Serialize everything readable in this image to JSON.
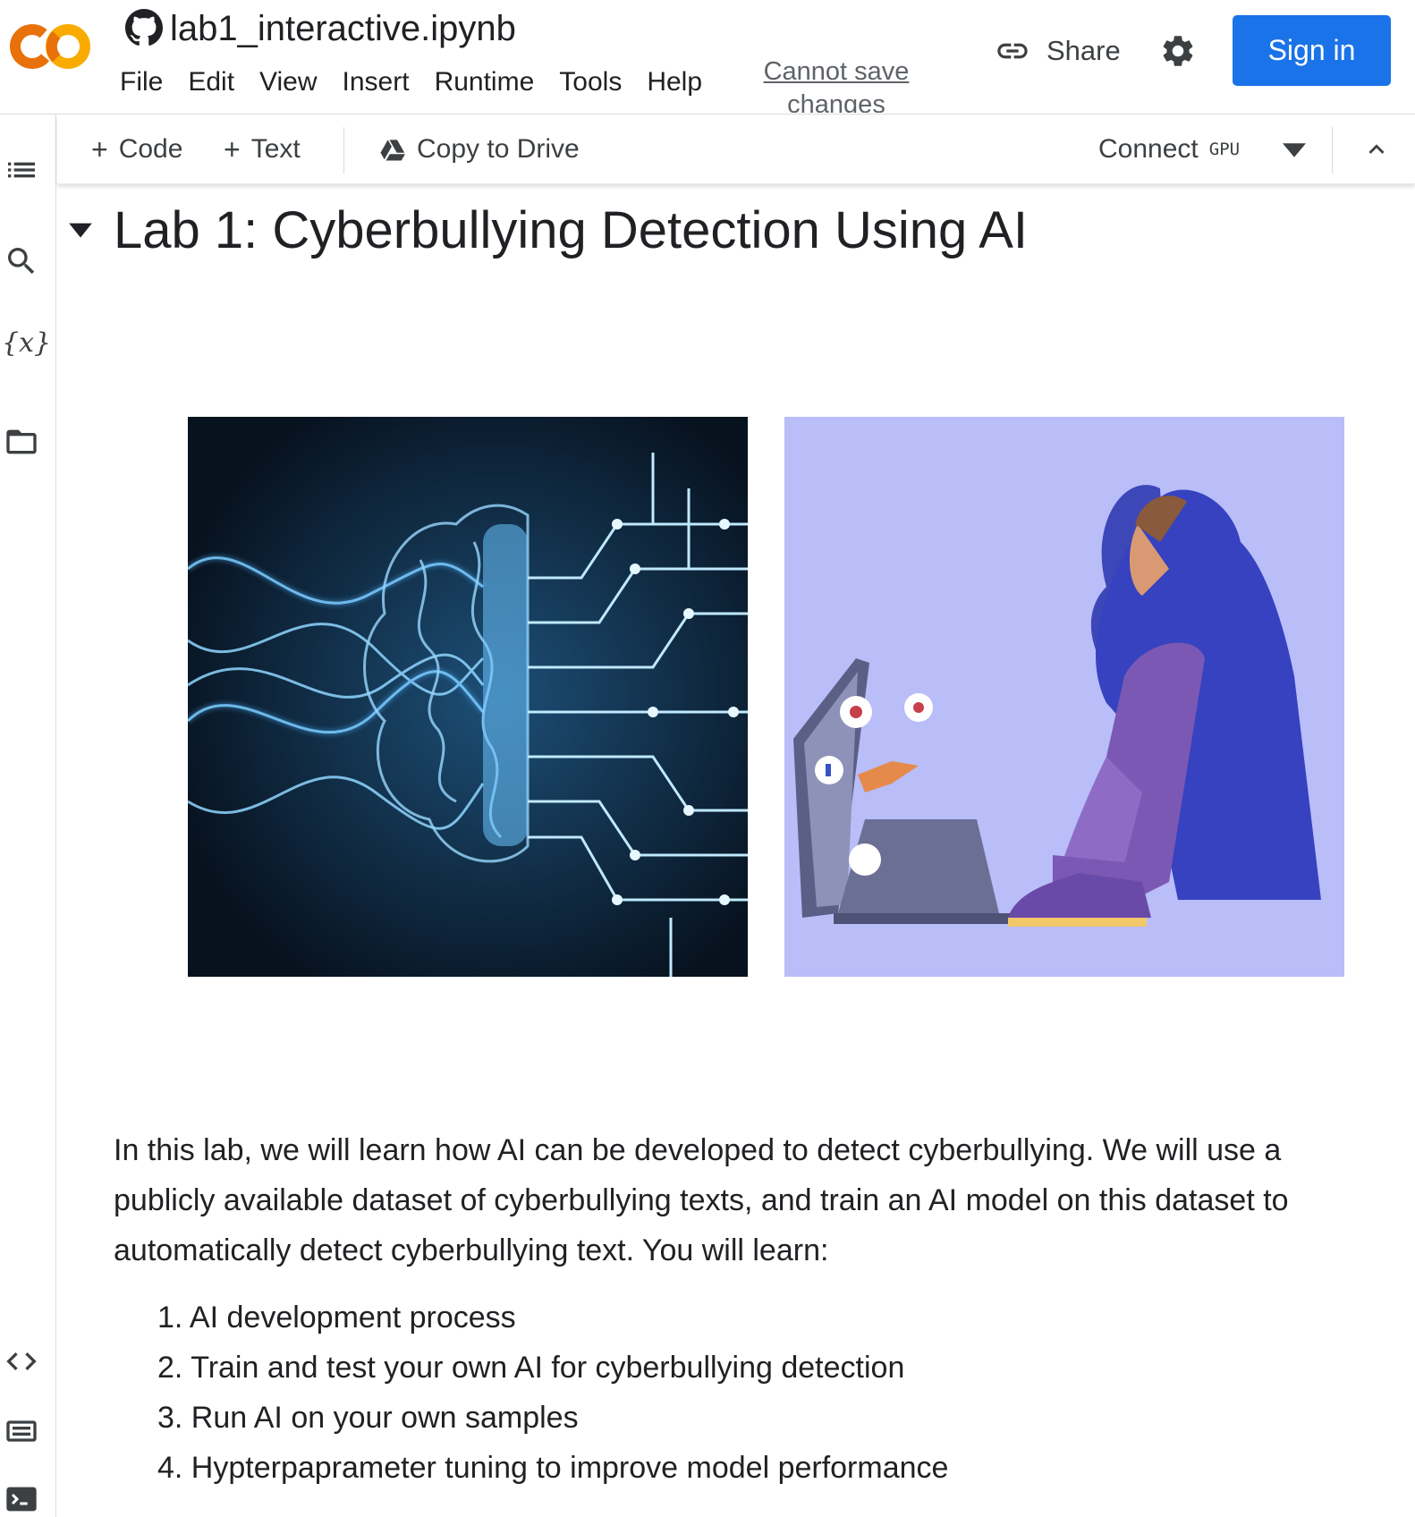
{
  "header": {
    "notebook_title": "lab1_interactive.ipynb",
    "menu": [
      "File",
      "Edit",
      "View",
      "Insert",
      "Runtime",
      "Tools",
      "Help"
    ],
    "save_status": "Cannot save changes",
    "share_label": "Share",
    "signin_label": "Sign in",
    "brand_colors": {
      "logo_orange_dark": "#E8710A",
      "logo_orange_light": "#F9AB00",
      "signin_blue": "#1A73E8"
    }
  },
  "toolbar": {
    "add_code": "Code",
    "add_text": "Text",
    "copy_to_drive": "Copy to Drive",
    "connect": "Connect",
    "runtime_type": "GPU"
  },
  "rail_icons": [
    "table-of-contents-icon",
    "search-icon",
    "variables-icon",
    "files-icon",
    "code-snippets-icon",
    "command-palette-icon",
    "terminal-icon"
  ],
  "variables_glyph": "{x}",
  "content": {
    "heading": "Lab 1: Cyberbullying Detection Using AI",
    "images": [
      {
        "name": "ai-brain-circuit-illustration"
      },
      {
        "name": "cyberbullied-person-illustration"
      }
    ],
    "intro": "In this lab, we will learn how AI can be developed to detect cyberbullying. We will use a publicly available dataset of cyberbullying texts, and train an AI model on this dataset to automatically detect cyberbullying text. You will learn:",
    "objectives": [
      "1. AI development process",
      "2. Train and test your own AI for cyberbullying detection",
      "3. Run AI on your own samples",
      "4. Hypterpaprameter tuning to improve model performance"
    ]
  }
}
